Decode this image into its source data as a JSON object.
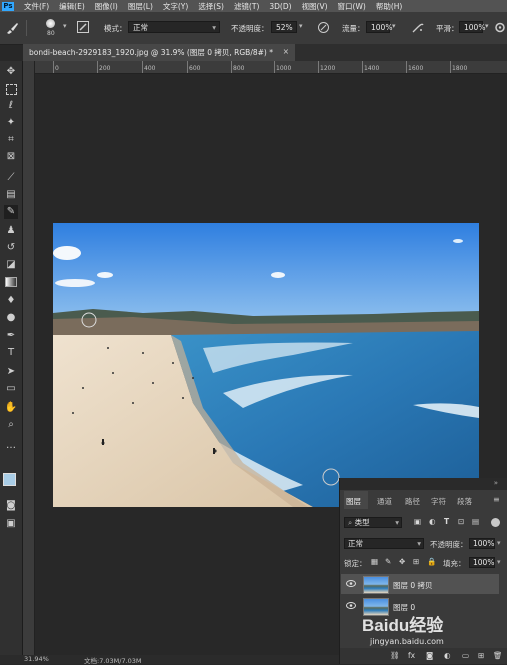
{
  "app": {
    "logo": "Ps"
  },
  "menu": [
    "文件(F)",
    "编辑(E)",
    "图像(I)",
    "图层(L)",
    "文字(Y)",
    "选择(S)",
    "滤镜(T)",
    "3D(D)",
    "视图(V)",
    "窗口(W)",
    "帮助(H)"
  ],
  "options": {
    "brush_size": "80",
    "mode_label": "模式：",
    "mode_value": "正常",
    "opacity_label": "不透明度：",
    "opacity_value": "52%",
    "flow_label": "流量：",
    "flow_value": "100%",
    "smooth_label": "平滑：",
    "smooth_value": "100%"
  },
  "document": {
    "tab_title": "bondi-beach-2929183_1920.jpg @ 31.9% (图层 0 拷贝, RGB/8#) *",
    "tab_close": "×"
  },
  "ruler": {
    "h_ticks": [
      "0",
      "200",
      "400",
      "600",
      "800",
      "1000",
      "1200",
      "1400",
      "1600",
      "1800"
    ]
  },
  "layers_panel": {
    "tabs": [
      "图层",
      "通道",
      "路径",
      "字符",
      "段落"
    ],
    "filter_label": "类型",
    "blend_mode": "正常",
    "opacity_label": "不透明度：",
    "opacity_value": "100%",
    "lock_label": "锁定：",
    "fill_label": "填充：",
    "fill_value": "100%",
    "layers": [
      {
        "name": "图层 0 拷贝",
        "selected": true
      },
      {
        "name": "图层 0",
        "selected": false
      }
    ]
  },
  "status": {
    "zoom": "31.94%",
    "doc_info": "文档:7.03M/7.03M"
  },
  "watermark": {
    "brand": "Baidu经验",
    "url": "jingyan.baidu.com"
  },
  "colors": {
    "fg": "#a9cde6",
    "bg": "#ffffff",
    "ps_blue": "#31a8ff"
  },
  "icons": [
    "brush-icon",
    "move-icon",
    "marquee-icon",
    "lasso-icon",
    "magic-wand-icon",
    "crop-icon",
    "frame-icon",
    "eyedropper-icon",
    "healing-icon",
    "brush-tool-icon",
    "stamp-icon",
    "history-brush-icon",
    "eraser-icon",
    "gradient-icon",
    "blur-icon",
    "dodge-icon",
    "pen-icon",
    "type-icon",
    "path-select-icon",
    "shape-icon",
    "hand-icon",
    "zoom-icon",
    "eye-icon"
  ]
}
